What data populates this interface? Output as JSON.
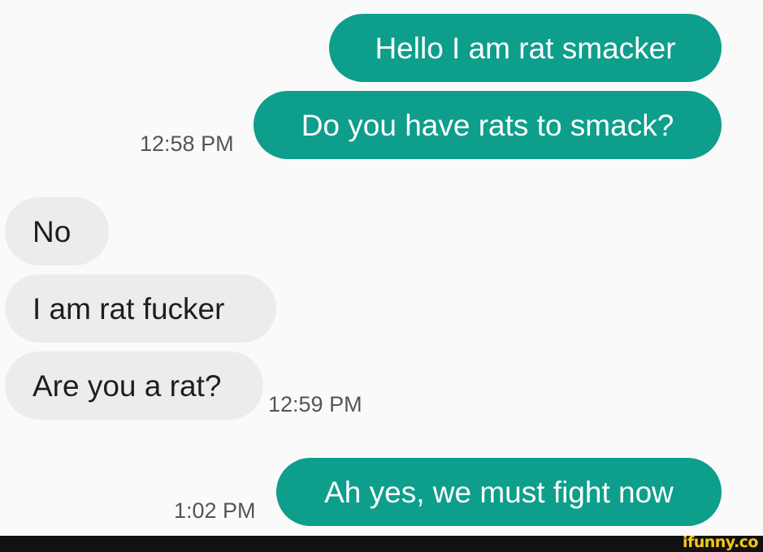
{
  "messages": [
    {
      "text": "Hello I am rat smacker",
      "direction": "outgoing"
    },
    {
      "text": "Do you have rats to smack?",
      "direction": "outgoing",
      "time": "12:58 PM"
    },
    {
      "text": "No",
      "direction": "incoming"
    },
    {
      "text": "I am rat fucker",
      "direction": "incoming"
    },
    {
      "text": "Are you a rat?",
      "direction": "incoming",
      "time": "12:59 PM"
    },
    {
      "text": "Ah yes, we must fight now",
      "direction": "outgoing",
      "time": "1:02 PM"
    }
  ],
  "watermark": {
    "text": "ifunny.co",
    "color": "#f5c518"
  },
  "colors": {
    "outgoing_bubble": "#0e9e8c",
    "incoming_bubble": "#ececec",
    "background": "#fafafa"
  }
}
